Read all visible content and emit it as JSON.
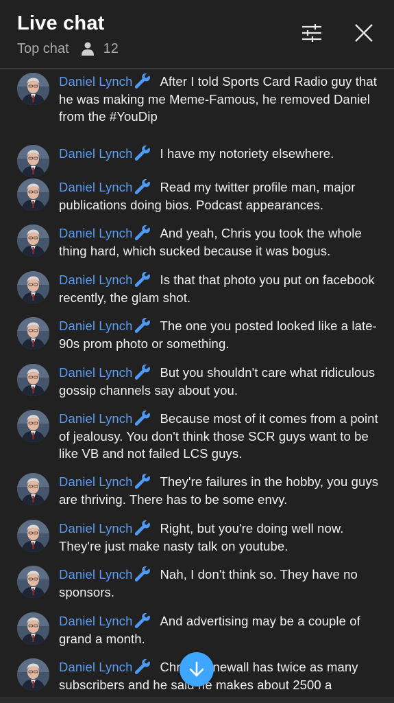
{
  "header": {
    "title": "Live chat",
    "mode_label": "Top chat",
    "viewer_count": "12",
    "filter_icon": "sliders-icon",
    "close_icon": "close-icon"
  },
  "colors": {
    "background": "#212121",
    "author": "#5b9cf2",
    "wrench": "#4d9bf5",
    "scroll_button": "#3ea6ff"
  },
  "messages": [
    {
      "author": "Daniel Lynch",
      "badge": "wrench-icon",
      "text": "After I told Sports Card Radio guy that he was making me Meme-Famous, he removed Daniel from the #YouDip"
    },
    {
      "author": "Daniel Lynch",
      "badge": "wrench-icon",
      "text": "I have my notoriety elsewhere."
    },
    {
      "author": "Daniel Lynch",
      "badge": "wrench-icon",
      "text": "Read my twitter profile man, major publications doing bios. Podcast appearances."
    },
    {
      "author": "Daniel Lynch",
      "badge": "wrench-icon",
      "text": "And yeah, Chris you took the whole thing hard, which sucked because it was bogus."
    },
    {
      "author": "Daniel Lynch",
      "badge": "wrench-icon",
      "text": "Is that that photo you put on facebook recently, the glam shot."
    },
    {
      "author": "Daniel Lynch",
      "badge": "wrench-icon",
      "text": "The one you posted looked like a late-90s prom photo or something."
    },
    {
      "author": "Daniel Lynch",
      "badge": "wrench-icon",
      "text": "But you shouldn't care what ridiculous gossip channels say about you."
    },
    {
      "author": "Daniel Lynch",
      "badge": "wrench-icon",
      "text": "Because most of it comes from a point of jealousy. You don't think those SCR guys want to be like VB and not failed LCS guys."
    },
    {
      "author": "Daniel Lynch",
      "badge": "wrench-icon",
      "text": "They're failures in the hobby, you guys are thriving. There has to be some envy."
    },
    {
      "author": "Daniel Lynch",
      "badge": "wrench-icon",
      "text": "Right, but you're doing well now. They're just make nasty talk on youtube."
    },
    {
      "author": "Daniel Lynch",
      "badge": "wrench-icon",
      "text": "Nah, I don't think so. They have no sponsors."
    },
    {
      "author": "Daniel Lynch",
      "badge": "wrench-icon",
      "text": "And advertising may be a couple of grand a month."
    },
    {
      "author": "Daniel Lynch",
      "badge": "wrench-icon",
      "text": "Chris Stonewall has twice as many subscribers and he said he makes about 2500 a"
    }
  ],
  "scroll_button_icon": "arrow-down-icon"
}
